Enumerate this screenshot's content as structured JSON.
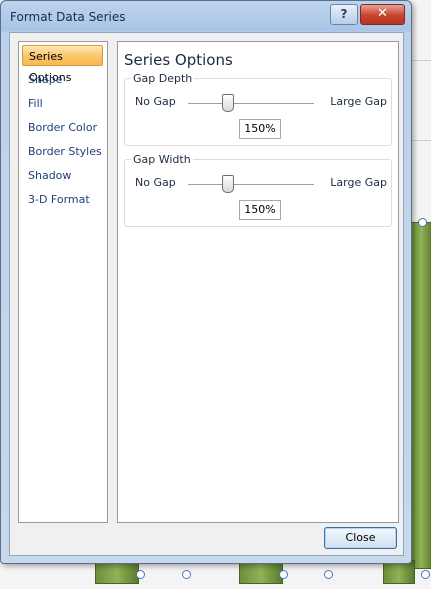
{
  "window": {
    "title": "Format Data Series",
    "help_label": "?",
    "close_label": "✕"
  },
  "sidebar": {
    "items": [
      {
        "label": "Series Options",
        "selected": true
      },
      {
        "label": "Shape",
        "selected": false
      },
      {
        "label": "Fill",
        "selected": false
      },
      {
        "label": "Border Color",
        "selected": false
      },
      {
        "label": "Border Styles",
        "selected": false
      },
      {
        "label": "Shadow",
        "selected": false
      },
      {
        "label": "3-D Format",
        "selected": false
      }
    ]
  },
  "panel": {
    "title": "Series Options",
    "gap_depth": {
      "label": "Gap Depth",
      "left_label": "No Gap",
      "right_label": "Large Gap",
      "value": "150%"
    },
    "gap_width": {
      "label": "Gap Width",
      "left_label": "No Gap",
      "right_label": "Large Gap",
      "value": "150%"
    }
  },
  "footer": {
    "close_button": "Close"
  },
  "colors": {
    "selected_item": "#f9c66a",
    "nav_text": "#1e3f7a",
    "chart_bar": "#6e8f3b",
    "close_x": "#c9442f"
  }
}
